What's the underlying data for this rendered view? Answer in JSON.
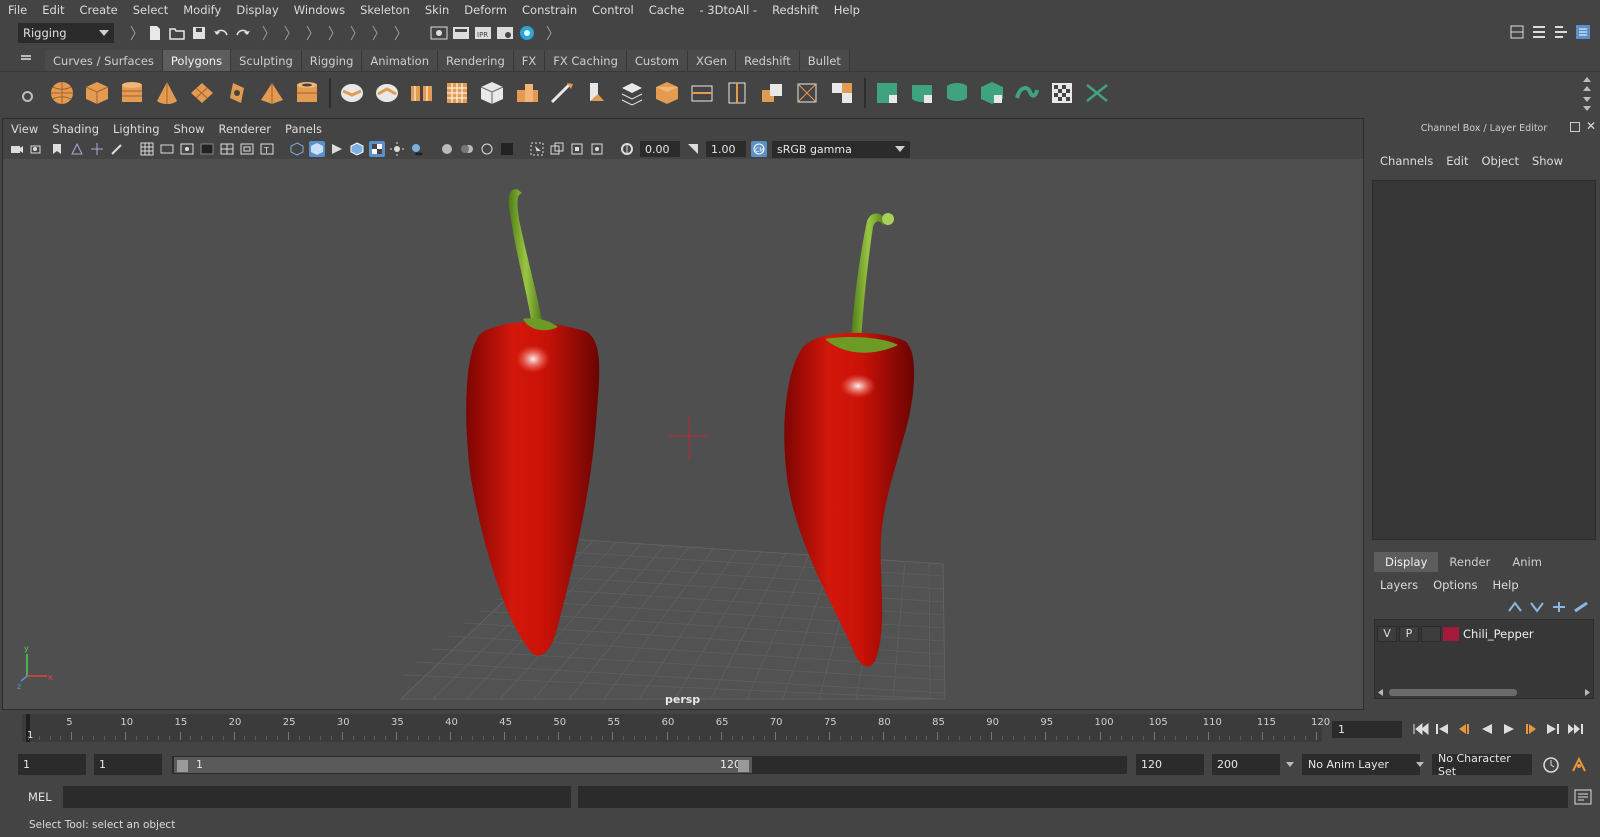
{
  "menubar": {
    "items": [
      "File",
      "Edit",
      "Create",
      "Select",
      "Modify",
      "Display",
      "Windows",
      "Skeleton",
      "Skin",
      "Deform",
      "Constrain",
      "Control",
      "Cache",
      "- 3DtoAll -",
      "Redshift",
      "Help"
    ]
  },
  "statusline": {
    "mode": "Rigging"
  },
  "shelf": {
    "tabs": [
      "Curves / Surfaces",
      "Polygons",
      "Sculpting",
      "Rigging",
      "Animation",
      "Rendering",
      "FX",
      "FX Caching",
      "Custom",
      "XGen",
      "Redshift",
      "Bullet"
    ],
    "active_tab": "Polygons"
  },
  "viewport": {
    "menu": [
      "View",
      "Shading",
      "Lighting",
      "Show",
      "Renderer",
      "Panels"
    ],
    "exposure": "0.00",
    "gamma": "1.00",
    "colorspace": "sRGB gamma",
    "camera_label": "persp"
  },
  "channelbox": {
    "title": "Channel Box / Layer Editor",
    "menu": [
      "Channels",
      "Edit",
      "Object",
      "Show"
    ]
  },
  "layereditor": {
    "tabs": [
      "Display",
      "Render",
      "Anim"
    ],
    "active_tab": "Display",
    "menu": [
      "Layers",
      "Options",
      "Help"
    ],
    "layers": [
      {
        "visible": "V",
        "playback": "P",
        "name": "Chili_Pepper",
        "color": "#a31a3a"
      }
    ]
  },
  "timeline": {
    "ticks": [
      "5",
      "10",
      "15",
      "20",
      "25",
      "30",
      "35",
      "40",
      "45",
      "50",
      "55",
      "60",
      "65",
      "70",
      "75",
      "80",
      "85",
      "90",
      "95",
      "100",
      "105",
      "110",
      "115",
      "120"
    ],
    "current_frame_mark": "1",
    "current_frame": "1"
  },
  "range": {
    "start": "1",
    "playback_start": "1",
    "slider_start": "1",
    "slider_end": "120",
    "playback_end": "120",
    "end": "200",
    "anim_layer": "No Anim Layer",
    "character_set": "No Character Set"
  },
  "commandline": {
    "label": "MEL"
  },
  "helpline": {
    "text": "Select Tool: select an object"
  },
  "colors": {
    "background": "#444444",
    "viewport_bg": "#4f4f4f",
    "field_bg": "#2b2b2b",
    "active_tab": "#5d5d5d",
    "selection_blue": "#5b8fc7",
    "pepper_red": "#c8130b",
    "stem_green": "#7fae2b"
  }
}
